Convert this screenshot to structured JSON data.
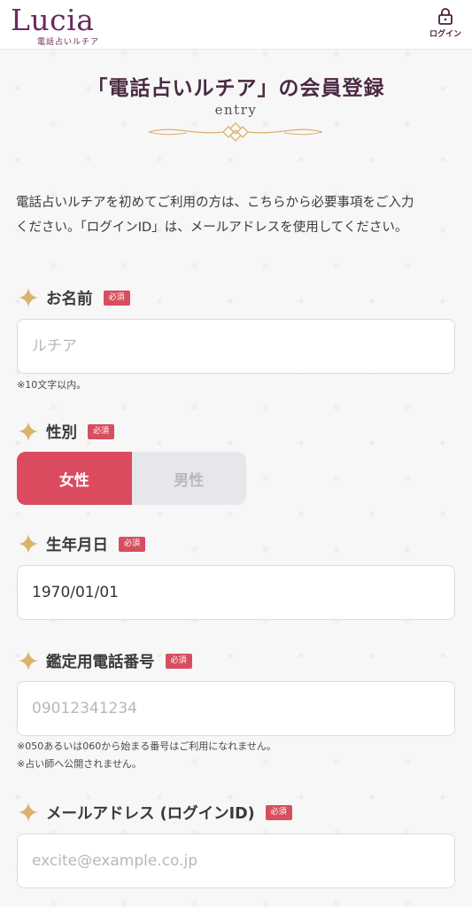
{
  "header": {
    "logo_text": "Lucia",
    "logo_subtext": "電話占いルチア",
    "login_label": "ログイン"
  },
  "page": {
    "title": "「電話占いルチア」の会員登録",
    "subtitle": "entry",
    "intro_line1": "電話占いルチアを初めてご利用の方は、こちらから必要事項をご入力",
    "intro_line2": "ください。「ログインID」は、メールアドレスを使用してください。"
  },
  "form": {
    "name": {
      "label": "お名前",
      "required_badge": "必須",
      "placeholder": "ルチア",
      "note": "※10文字以内。"
    },
    "gender": {
      "label": "性別",
      "required_badge": "必須",
      "options": [
        "女性",
        "男性"
      ],
      "selected": "女性"
    },
    "birthdate": {
      "label": "生年月日",
      "required_badge": "必須",
      "value": "1970/01/01"
    },
    "phone": {
      "label": "鑑定用電話番号",
      "required_badge": "必須",
      "placeholder": "09012341234",
      "note1": "※050あるいは060から始まる番号はご利用になれません。",
      "note2": "※占い師へ公開されません。"
    },
    "email": {
      "label": "メールアドレス (ログインID)",
      "required_badge": "必須",
      "placeholder": "excite@example.co.jp"
    }
  },
  "colors": {
    "accent_red": "#dc4a5f",
    "brand_purple": "#6b2a5e",
    "star_gold": "#d9b36c"
  }
}
